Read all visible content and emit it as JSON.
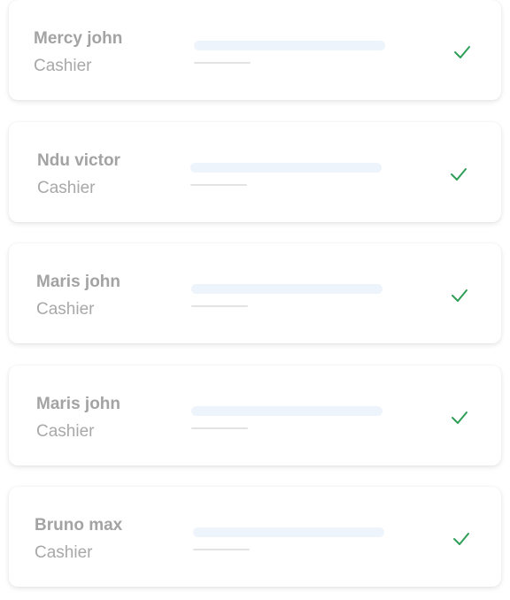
{
  "accent_color": "#2e9e57",
  "employees": [
    {
      "name": "Mercy john",
      "role": "Cashier",
      "status_icon": "check-icon"
    },
    {
      "name": "Ndu victor",
      "role": "Cashier",
      "status_icon": "check-icon"
    },
    {
      "name": "Maris john",
      "role": "Cashier",
      "status_icon": "check-icon"
    },
    {
      "name": "Maris john",
      "role": "Cashier",
      "status_icon": "check-icon"
    },
    {
      "name": "Bruno max",
      "role": "Cashier",
      "status_icon": "check-icon"
    }
  ]
}
